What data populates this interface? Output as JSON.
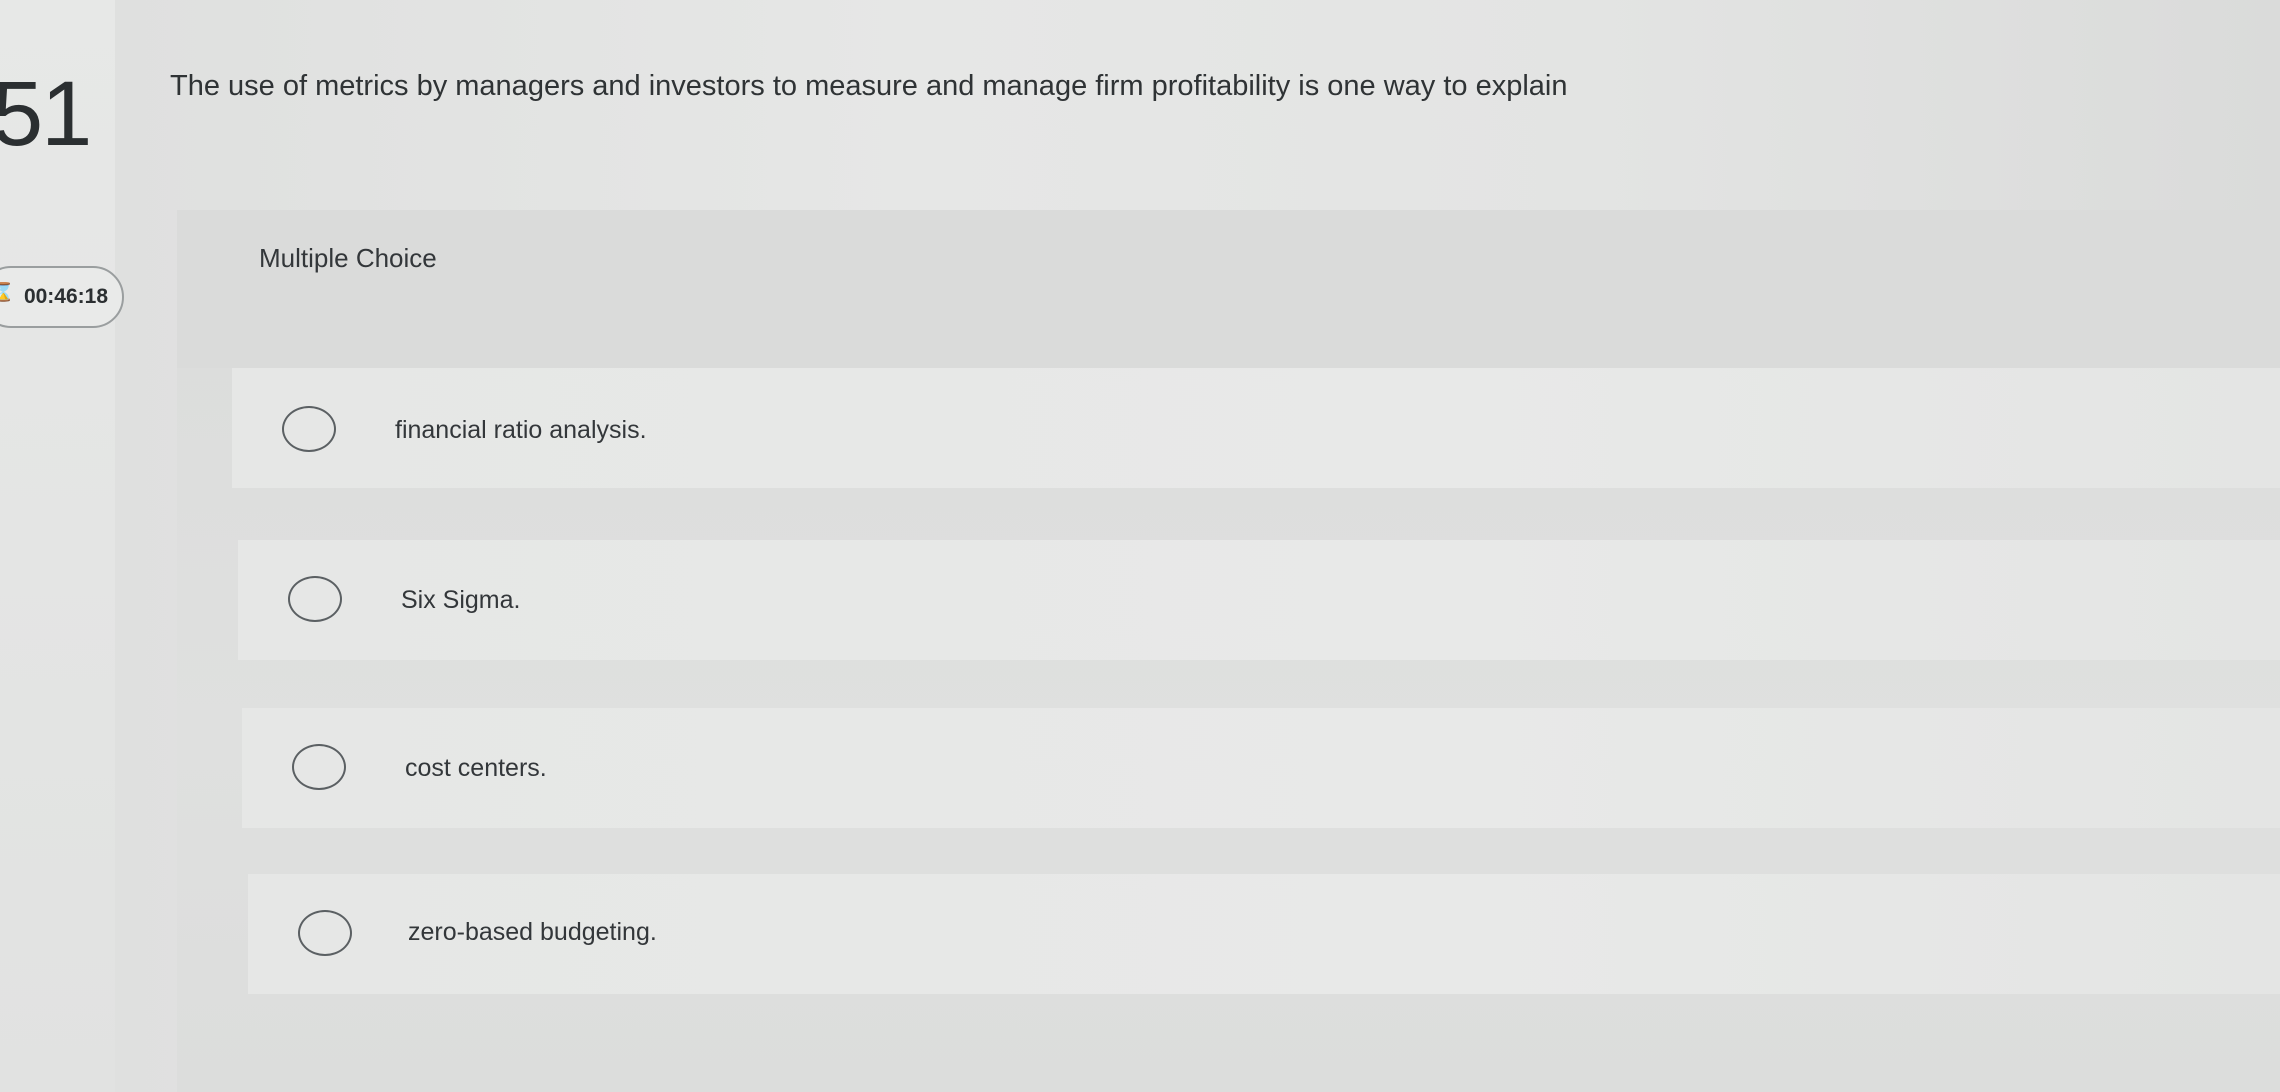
{
  "question": {
    "number": "51",
    "text": "The use of metrics by managers and investors to measure and manage firm profitability is one way to explain"
  },
  "timer": {
    "value": "00:46:18",
    "icon": "hourglass-icon"
  },
  "choices": {
    "label": "Multiple Choice",
    "options": [
      {
        "text": "financial ratio analysis."
      },
      {
        "text": "Six Sigma."
      },
      {
        "text": "cost centers."
      },
      {
        "text": "zero-based budgeting."
      }
    ]
  }
}
